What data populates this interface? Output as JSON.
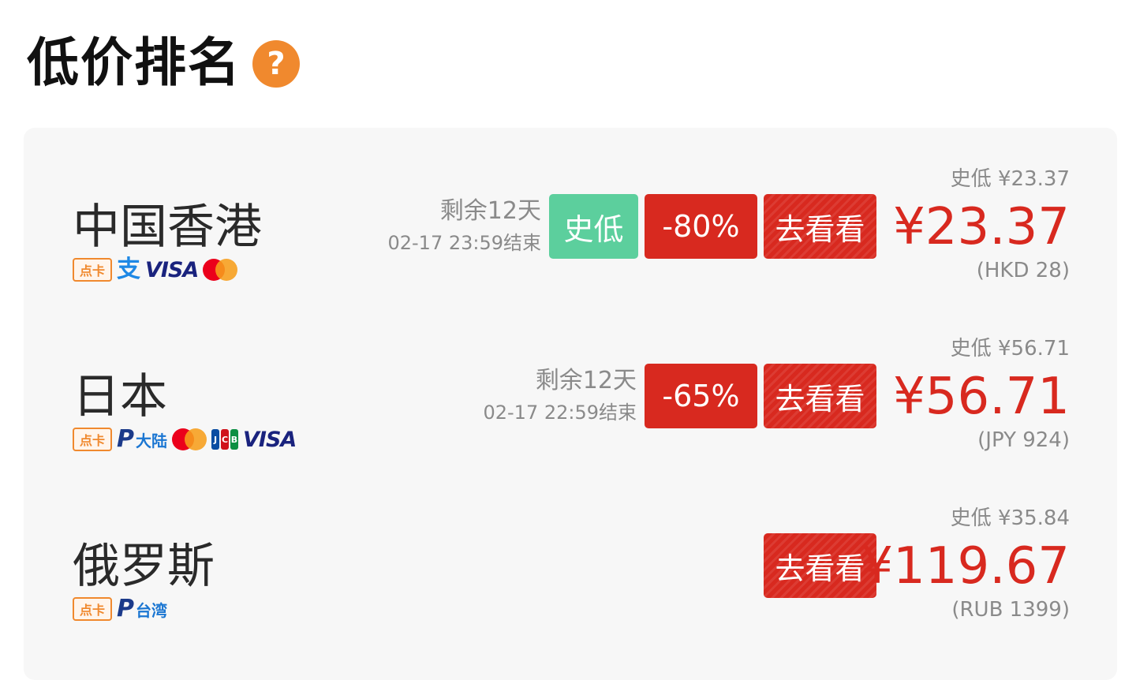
{
  "header": {
    "title": "低价排名",
    "help_icon": "?"
  },
  "rows": [
    {
      "country": "中国香港",
      "payment": {
        "card_tag": "点卡",
        "alipay_glyph": "支",
        "visa": "VISA",
        "icons": [
          "card-tag-icon",
          "alipay-icon",
          "visa-icon",
          "mastercard-icon"
        ]
      },
      "remaining": "剩余12天",
      "end_time": "02-17 23:59结束",
      "low_badge": "史低",
      "discount": "-80%",
      "go_label": "去看看",
      "history_low": "史低 ¥23.37",
      "price": "¥23.37",
      "original": "(HKD 28)"
    },
    {
      "country": "日本",
      "payment": {
        "card_tag": "点卡",
        "paypal_region": "大陆",
        "jcb": [
          "J",
          "C",
          "B"
        ],
        "visa": "VISA",
        "icons": [
          "card-tag-icon",
          "paypal-icon",
          "mastercard-icon",
          "jcb-icon",
          "visa-icon"
        ]
      },
      "remaining": "剩余12天",
      "end_time": "02-17 22:59结束",
      "discount": "-65%",
      "go_label": "去看看",
      "history_low": "史低 ¥56.71",
      "price": "¥56.71",
      "original": "(JPY 924)"
    },
    {
      "country": "俄罗斯",
      "payment": {
        "card_tag": "点卡",
        "paypal_region": "台湾",
        "icons": [
          "card-tag-icon",
          "paypal-icon"
        ]
      },
      "go_label": "去看看",
      "history_low": "史低 ¥35.84",
      "price": "¥119.67",
      "original": "(RUB 1399)"
    }
  ],
  "colors": {
    "accent_red": "#d8291f",
    "historic_low_green": "#5ccf9d",
    "help_orange": "#f0892e",
    "panel_bg": "#f7f7f7"
  }
}
